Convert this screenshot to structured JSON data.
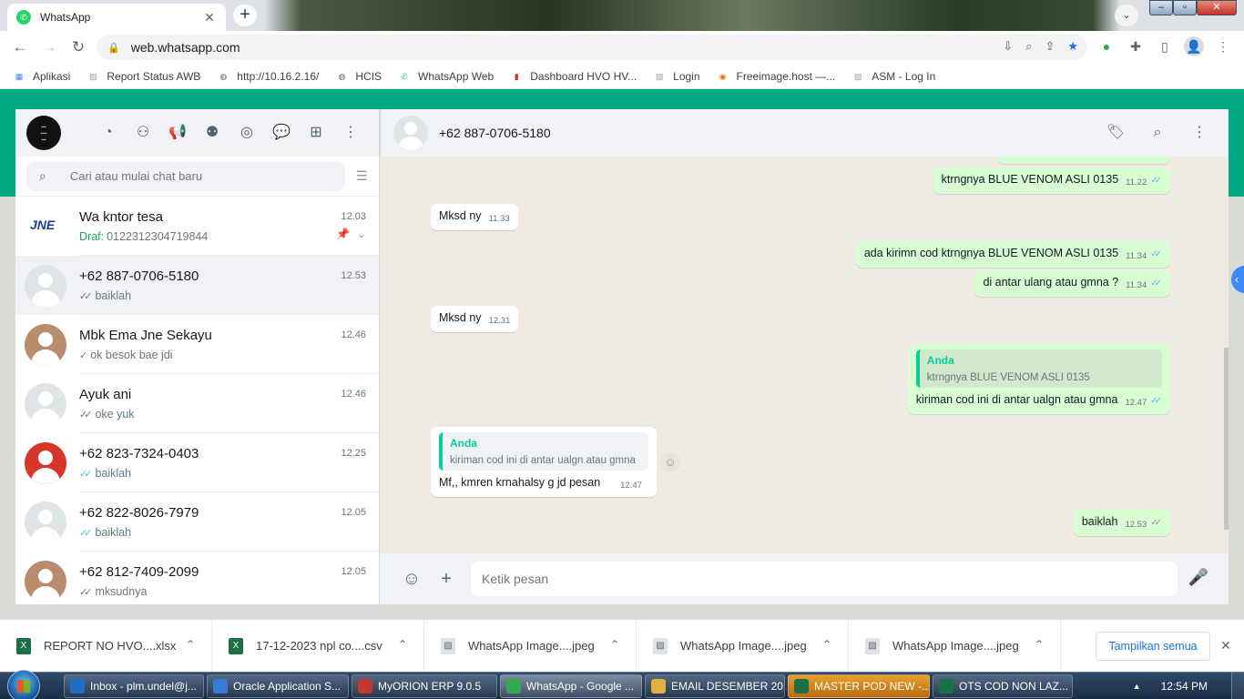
{
  "browser": {
    "tab_title": "WhatsApp",
    "url": "web.whatsapp.com"
  },
  "bookmarks": [
    {
      "label": "Aplikasi",
      "icon": "apps-grid-icon",
      "color": "#4285f4"
    },
    {
      "label": "Report Status AWB",
      "icon": "broken-image-icon",
      "color": "#9aa0a6"
    },
    {
      "label": "http://10.16.2.16/",
      "icon": "globe-icon",
      "color": "#5f6368"
    },
    {
      "label": "HCIS",
      "icon": "globe-icon",
      "color": "#5f6368"
    },
    {
      "label": "WhatsApp Web",
      "icon": "whatsapp-icon",
      "color": "#25d366"
    },
    {
      "label": "Dashboard HVO HV...",
      "icon": "red-page-icon",
      "color": "#d93025"
    },
    {
      "label": "Login",
      "icon": "broken-image-icon",
      "color": "#9aa0a6"
    },
    {
      "label": "Freeimage.host —...",
      "icon": "freeimage-icon",
      "color": "#e8710a"
    },
    {
      "label": "ASM - Log In",
      "icon": "broken-image-icon",
      "color": "#9aa0a6"
    }
  ],
  "sidebar": {
    "search_placeholder": "Cari atau mulai chat baru",
    "chats": [
      {
        "name": "Wa kntor tesa",
        "time": "12.03",
        "draft_label": "Draf:",
        "preview": "0122312304719844",
        "avatar": "jne-logo"
      },
      {
        "name": "+62 887-0706-5180",
        "time": "12.53",
        "preview": "baiklah",
        "tick": "✓✓",
        "tick_color": "grey",
        "active": true
      },
      {
        "name": "Mbk Ema Jne Sekayu",
        "time": "12.46",
        "preview": "ok besok bae jdi",
        "tick": "✓",
        "tick_color": "grey"
      },
      {
        "name": "Ayuk ani",
        "time": "12.46",
        "preview": "oke yuk",
        "tick": "✓✓",
        "tick_color": "grey"
      },
      {
        "name": "+62 823-7324-0403",
        "time": "12.25",
        "preview": "baiklah",
        "tick": "✓✓",
        "tick_color": "blue"
      },
      {
        "name": "+62 822-8026-7979",
        "time": "12.05",
        "preview": "baiklah",
        "tick": "✓✓",
        "tick_color": "blue"
      },
      {
        "name": "+62 812-7409-2099",
        "time": "12.05",
        "preview": "mksudnya",
        "tick": "✓✓",
        "tick_color": "grey"
      }
    ]
  },
  "conversation": {
    "contact": "+62 887-0706-5180",
    "compose_placeholder": "Ketik pesan",
    "messages": [
      {
        "dir": "out",
        "text": "ktrngnya BLUE VENOM ASLI 0135",
        "time": "11.22",
        "tick": "✓✓"
      },
      {
        "dir": "in",
        "text": "Mksd ny",
        "time": "11.33"
      },
      {
        "dir": "out",
        "text": "ada kirimn cod ktrngnya BLUE VENOM ASLI 0135",
        "time": "11.34",
        "tick": "✓✓"
      },
      {
        "dir": "out",
        "text": "di antar ulang atau gmna ?",
        "time": "11.34",
        "tick": "✓✓"
      },
      {
        "dir": "in",
        "text": "Mksd ny",
        "time": "12.31"
      },
      {
        "dir": "out",
        "quote_name": "Anda",
        "quote_text": "ktrngnya BLUE VENOM ASLI 0135",
        "text": "kiriman cod ini di antar ualgn atau gmna",
        "time": "12.47",
        "tick": "✓✓"
      },
      {
        "dir": "in",
        "quote_name": "Anda",
        "quote_text": "kiriman cod ini di antar ualgn atau gmna",
        "text": "Mf,, kmren krnahalsy g jd pesan",
        "time": "12.47"
      },
      {
        "dir": "out",
        "text": "baiklah",
        "time": "12.53",
        "tick": "✓✓"
      }
    ]
  },
  "downloads": {
    "items": [
      {
        "name": "REPORT NO HVO....xlsx",
        "type": "excel"
      },
      {
        "name": "17-12-2023 npl co....csv",
        "type": "excel"
      },
      {
        "name": "WhatsApp Image....jpeg",
        "type": "image"
      },
      {
        "name": "WhatsApp Image....jpeg",
        "type": "image"
      },
      {
        "name": "WhatsApp Image....jpeg",
        "type": "image"
      }
    ],
    "show_all": "Tampilkan semua"
  },
  "taskbar": {
    "items": [
      {
        "label": "Inbox - plm.undel@j...",
        "icon_color": "#1f6fc5"
      },
      {
        "label": "Oracle Application S...",
        "icon_color": "#3a7bd5"
      },
      {
        "label": "MyORION ERP 9.0.5",
        "icon_color": "#c0392b"
      },
      {
        "label": "WhatsApp - Google ...",
        "icon_color": "#34a853",
        "active": true
      },
      {
        "label": "EMAIL DESEMBER 20...",
        "icon_color": "#e0b040"
      },
      {
        "label": "MASTER POD NEW -...",
        "icon_color": "#1d7044",
        "highlight": true
      },
      {
        "label": "OTS COD  NON LAZ...",
        "icon_color": "#1d7044"
      }
    ],
    "clock": "12:54 PM"
  }
}
